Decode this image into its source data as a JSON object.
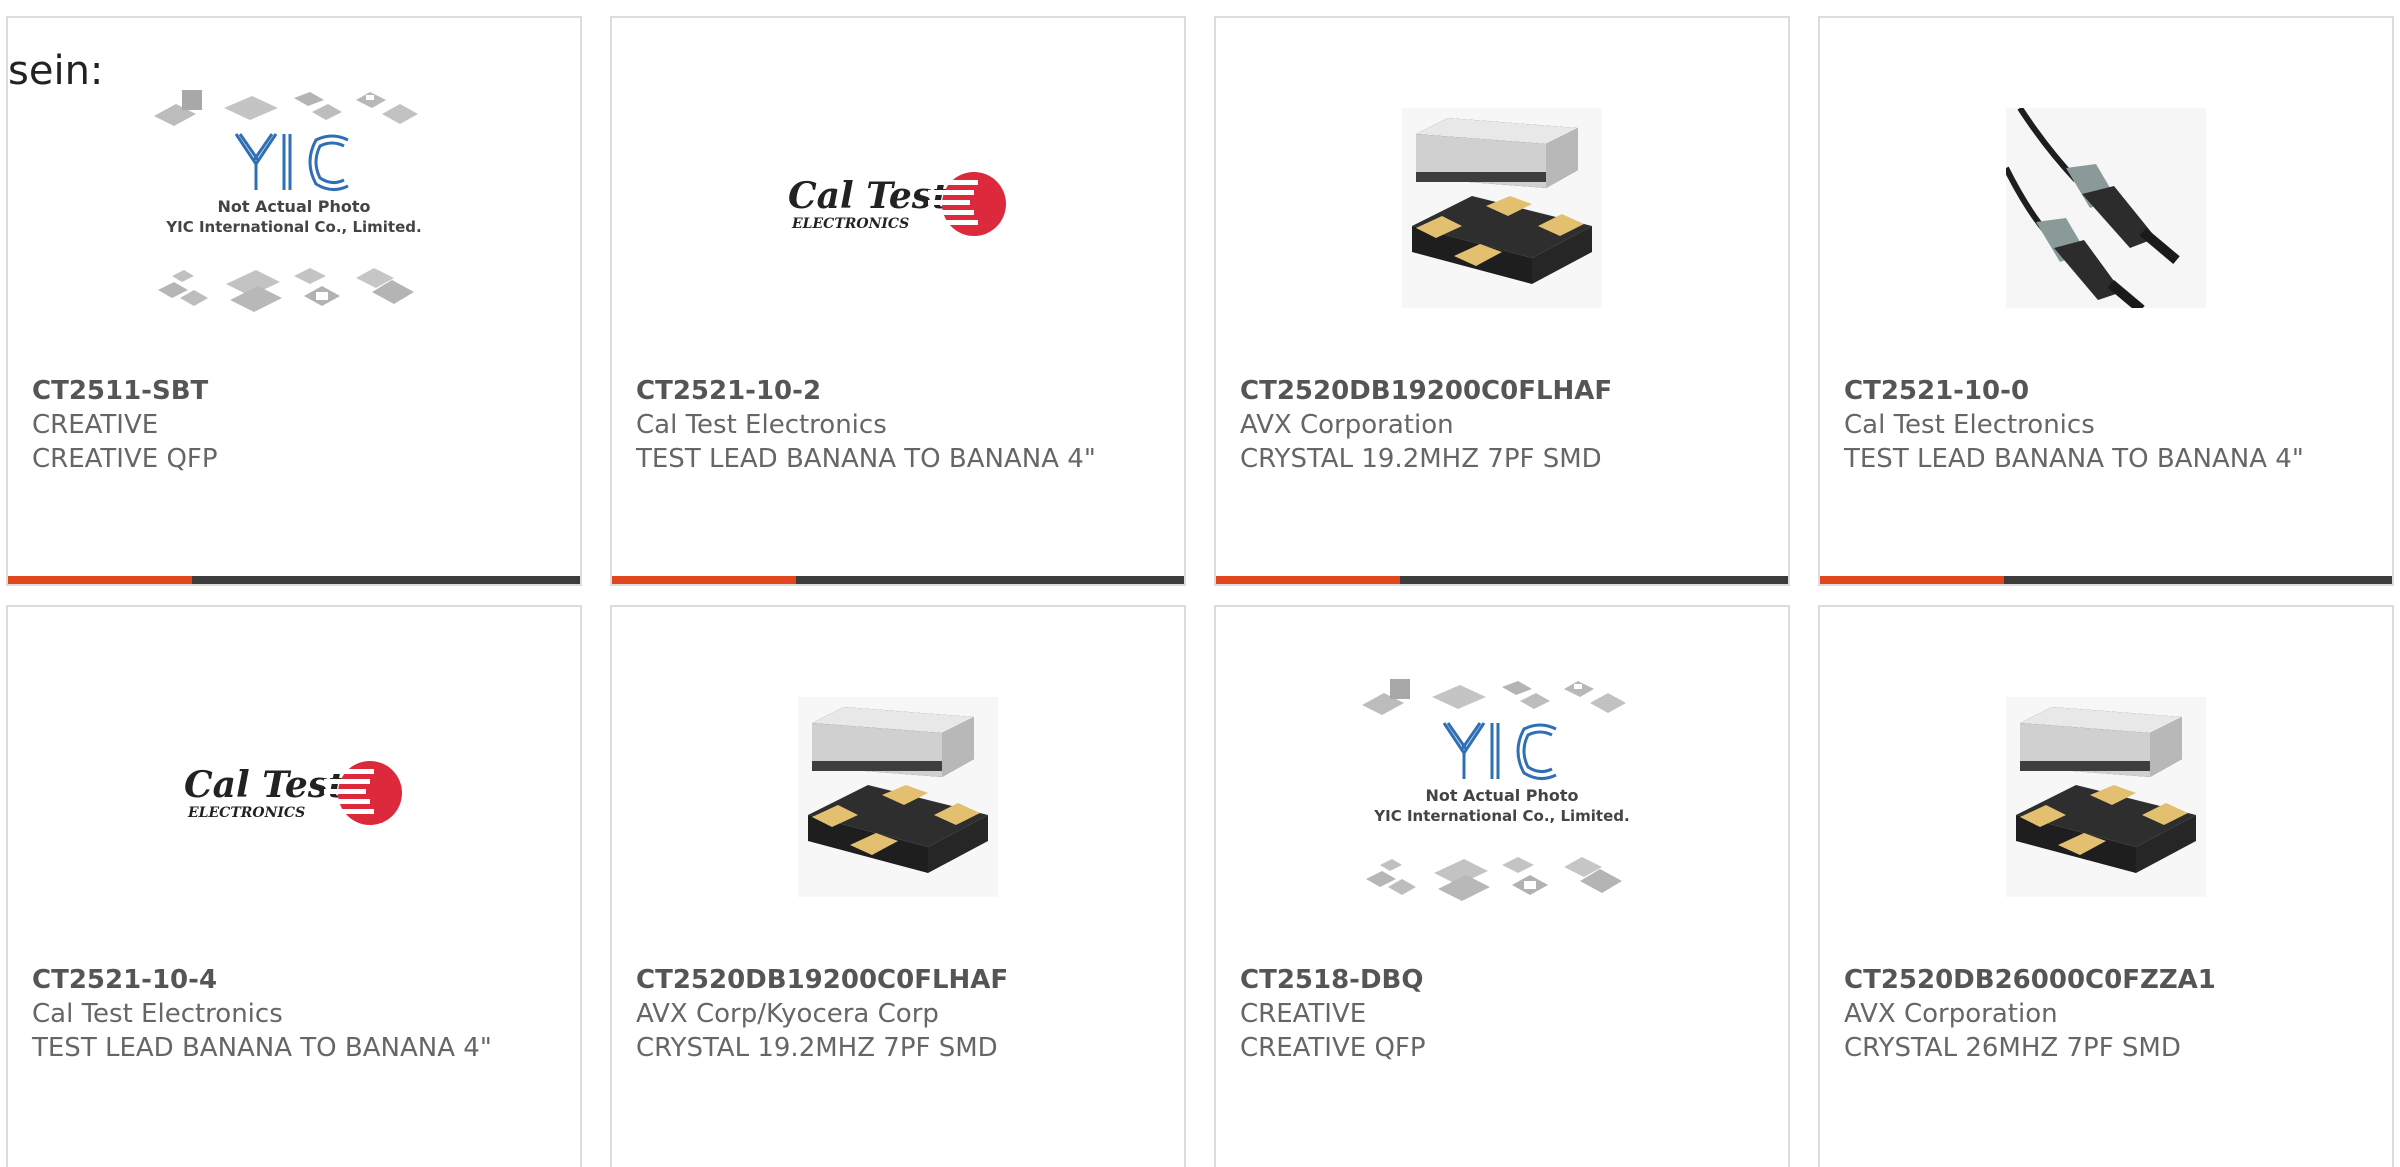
{
  "stray_label": "sein:",
  "colors": {
    "accent": "#e2461c",
    "bar_dark": "#3c3c3c",
    "card_border": "#dcdcdc",
    "text": "#666666"
  },
  "products": [
    {
      "part_number": "CT2511-SBT",
      "manufacturer": "CREATIVE",
      "description": "CREATIVE QFP",
      "image": "yic-placeholder-image",
      "image_text": {
        "line1": "Not Actual Photo",
        "line2": "YIC International Co., Limited."
      }
    },
    {
      "part_number": "CT2521-10-2",
      "manufacturer": "Cal Test Electronics",
      "description": "TEST LEAD BANANA TO BANANA 4\"",
      "image": "cal-test-logo-image",
      "image_text": {
        "line1": "Cal Test",
        "line2": "ELECTRONICS"
      }
    },
    {
      "part_number": "CT2520DB19200C0FLHAF",
      "manufacturer": "AVX Corporation",
      "description": "CRYSTAL 19.2MHZ 7PF SMD",
      "image": "crystal-smd-image"
    },
    {
      "part_number": "CT2521-10-0",
      "manufacturer": "Cal Test Electronics",
      "description": "TEST LEAD BANANA TO BANANA 4\"",
      "image": "test-lead-image"
    },
    {
      "part_number": "CT2521-10-4",
      "manufacturer": "Cal Test Electronics",
      "description": "TEST LEAD BANANA TO BANANA 4\"",
      "image": "cal-test-logo-image",
      "image_text": {
        "line1": "Cal Test",
        "line2": "ELECTRONICS"
      }
    },
    {
      "part_number": "CT2520DB19200C0FLHAF",
      "manufacturer": "AVX Corp/Kyocera Corp",
      "description": "CRYSTAL 19.2MHZ 7PF SMD",
      "image": "crystal-smd-image"
    },
    {
      "part_number": "CT2518-DBQ",
      "manufacturer": "CREATIVE",
      "description": "CREATIVE QFP",
      "image": "yic-placeholder-image",
      "image_text": {
        "line1": "Not Actual Photo",
        "line2": "YIC International Co., Limited."
      }
    },
    {
      "part_number": "CT2520DB26000C0FZZA1",
      "manufacturer": "AVX Corporation",
      "description": "CRYSTAL 26MHZ 7PF SMD",
      "image": "crystal-smd-image"
    }
  ]
}
